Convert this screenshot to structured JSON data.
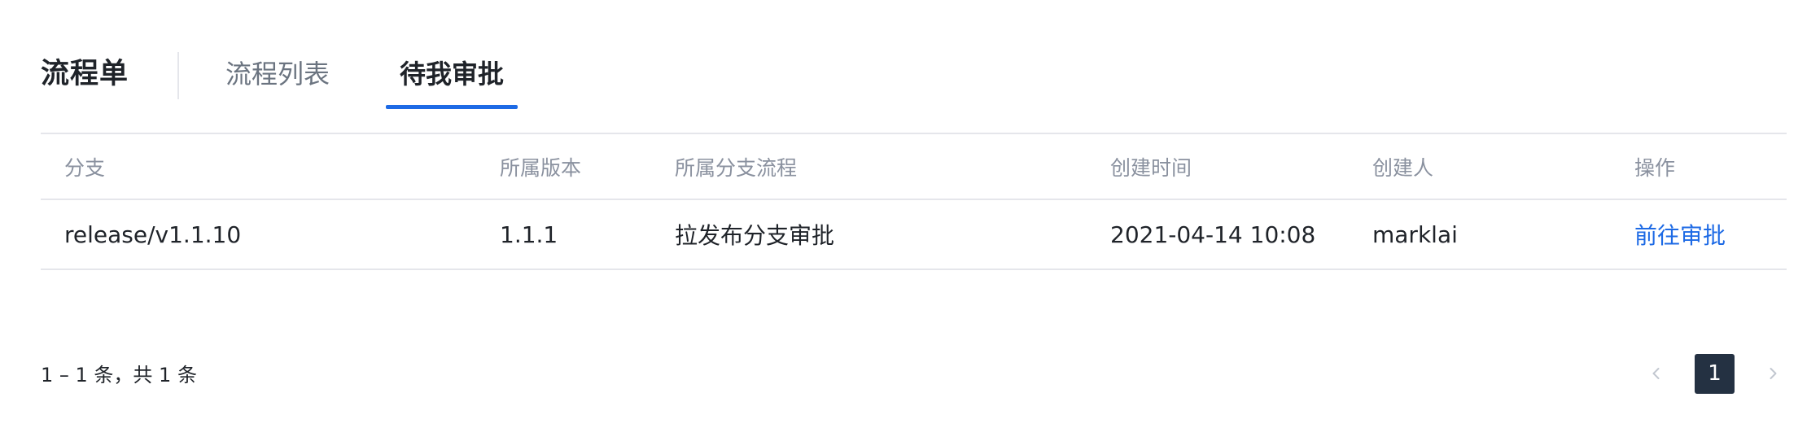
{
  "header": {
    "title": "流程单",
    "tabs": [
      {
        "label": "流程列表",
        "active": false
      },
      {
        "label": "待我审批",
        "active": true
      }
    ]
  },
  "table": {
    "columns": [
      "分支",
      "所属版本",
      "所属分支流程",
      "创建时间",
      "创建人",
      "操作"
    ],
    "rows": [
      {
        "branch": "release/v1.1.10",
        "version": "1.1.1",
        "flow": "拉发布分支审批",
        "created_at": "2021-04-14 10:08",
        "creator": "marklai",
        "action": "前往审批"
      }
    ]
  },
  "pagination": {
    "summary": "1 – 1 条，共 1 条",
    "current_page": "1",
    "prev_icon": "chevron-left-icon",
    "next_icon": "chevron-right-icon"
  },
  "colors": {
    "accent": "#1d6ae5",
    "active_page_bg": "#243142",
    "border": "#e5e6eb",
    "muted_text": "#8a919f"
  }
}
